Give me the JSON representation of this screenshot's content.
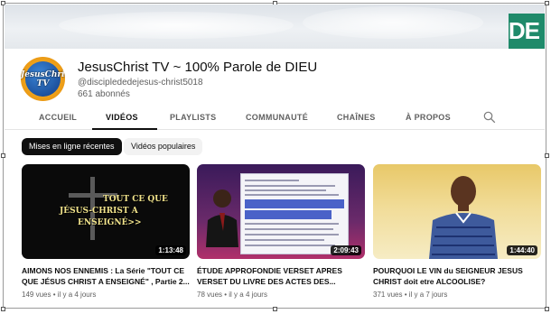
{
  "banner": {
    "brand_text": "DE"
  },
  "channel": {
    "avatar_text": "JesusChrist TV",
    "name": "JesusChrist TV ~ 100% Parole de DIEU",
    "handle": "@disciplededejesus-christ5018",
    "subscribers": "661 abonnés"
  },
  "tabs": [
    {
      "label": "ACCUEIL",
      "active": false
    },
    {
      "label": "VIDÉOS",
      "active": true
    },
    {
      "label": "PLAYLISTS",
      "active": false
    },
    {
      "label": "COMMUNAUTÉ",
      "active": false
    },
    {
      "label": "CHAÎNES",
      "active": false
    },
    {
      "label": "À PROPOS",
      "active": false
    }
  ],
  "chips": [
    {
      "label": "Mises en ligne récentes",
      "selected": true
    },
    {
      "label": "Vidéos populaires",
      "selected": false
    }
  ],
  "videos": [
    {
      "thumb_text": [
        "TOUT CE QUE",
        "JÉSUS-CHRIST A",
        "ENSEIGNÉ>>"
      ],
      "duration": "1:13:48",
      "title": "AIMONS NOS ENNEMIS : La Série \"TOUT CE QUE JÉSUS CHRIST A ENSEIGNÉ\" , Partie 2...",
      "meta": "149 vues • il y a 4 jours"
    },
    {
      "duration": "2:09:43",
      "title": "ÉTUDE APPROFONDIE VERSET APRES VERSET DU LIVRE DES ACTES DES...",
      "meta": "78 vues • il y a 4 jours"
    },
    {
      "duration": "1:44:40",
      "title": "POURQUOI LE VIN du SEIGNEUR JESUS CHRIST doit etre ALCOOLISE?",
      "meta": "371 vues • il y a 7 jours"
    }
  ],
  "colors": {
    "accent": "#0f0f0f",
    "secondary_text": "#606060",
    "chip_bg": "#f2f2f2"
  },
  "icons": {
    "search": "search-icon"
  }
}
